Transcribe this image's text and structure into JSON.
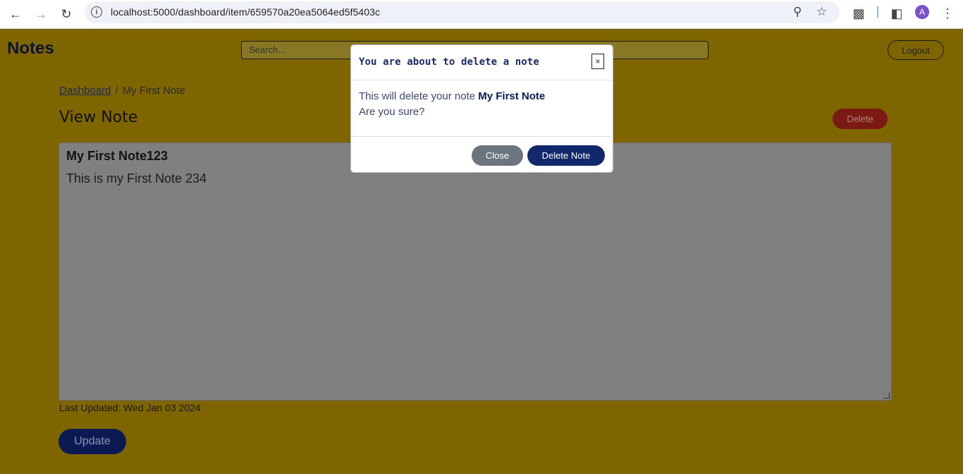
{
  "browser": {
    "url": "localhost:5000/dashboard/item/659570a20ea5064ed5f5403c",
    "avatar_letter": "A"
  },
  "header": {
    "brand": "Notes",
    "search_placeholder": "Search...",
    "logout_label": "Logout"
  },
  "breadcrumb": {
    "home": "Dashboard",
    "separator": "/",
    "current": "My First Note"
  },
  "page": {
    "title": "View Note",
    "delete_label": "Delete",
    "note_title": "My First Note123",
    "note_body": "This is my First Note 234",
    "last_updated": "Last Updated: Wed Jan 03 2024",
    "update_label": "Update"
  },
  "modal": {
    "title": "You are about to delete a note",
    "close_x": "×",
    "body_prefix": "This will delete your note ",
    "body_note_name": "My First Note",
    "body_question": "Are you sure?",
    "close_label": "Close",
    "delete_label": "Delete Note"
  }
}
